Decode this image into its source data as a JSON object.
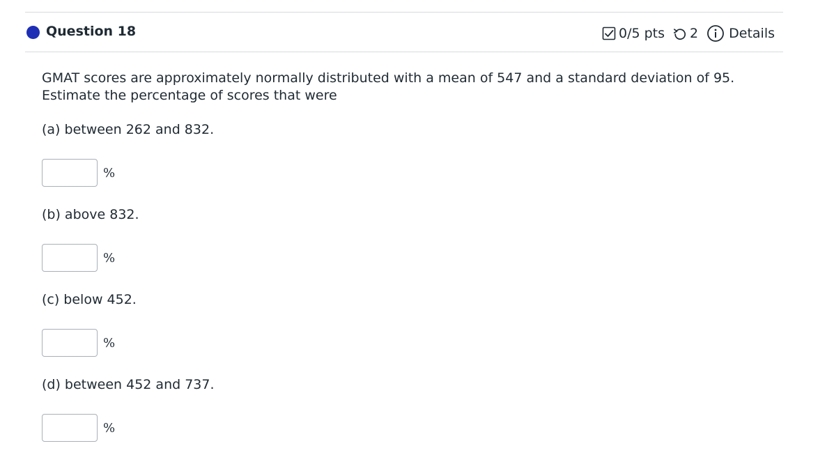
{
  "question": {
    "title": "Question 18",
    "points": "0/5 pts",
    "attempts": "2",
    "details_label": "Details",
    "stem": "GMAT scores are approximately normally distributed with a mean of 547 and a standard deviation of 95.",
    "stem2": "Estimate the percentage of scores that were"
  },
  "parts": [
    {
      "label": "(a) between 262 and 832.",
      "value": "",
      "unit": "%"
    },
    {
      "label": "(b) above 832.",
      "value": "",
      "unit": "%"
    },
    {
      "label": "(c) below 452.",
      "value": "",
      "unit": "%"
    },
    {
      "label": "(d) between 452 and 737.",
      "value": "",
      "unit": "%"
    }
  ],
  "colors": {
    "status_dot": "#1e2fb5",
    "text": "#1f2a33",
    "divider": "#d7dadd"
  },
  "icons": {
    "points": "checkbox-icon",
    "attempts": "retry-icon",
    "details": "info-icon"
  }
}
